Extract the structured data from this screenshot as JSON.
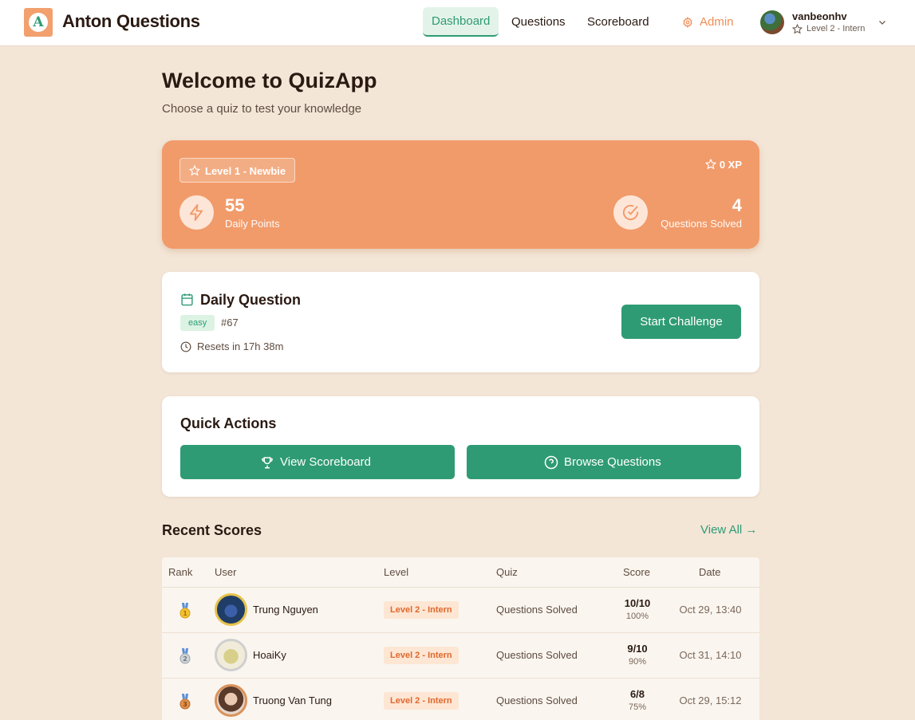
{
  "header": {
    "logo_letter": "A",
    "brand": "Anton Questions",
    "nav": [
      "Dashboard",
      "Questions",
      "Scoreboard"
    ],
    "admin": "Admin",
    "user": {
      "name": "vanbeonhv",
      "level": "Level 2 - Intern"
    }
  },
  "main": {
    "title": "Welcome to QuizApp",
    "subtitle": "Choose a quiz to test your knowledge"
  },
  "stats": {
    "level": "Level 1  - Newbie",
    "xp": "0 XP",
    "daily_points": "55",
    "daily_points_label": "Daily Points",
    "questions_solved": "4",
    "questions_solved_label": "Questions Solved"
  },
  "daily_question": {
    "title": "Daily Question",
    "difficulty": "easy",
    "number": "#67",
    "reset": "Resets in 17h 38m",
    "button": "Start Challenge"
  },
  "quick_actions": {
    "title": "Quick Actions",
    "scoreboard": "View Scoreboard",
    "browse": "Browse Questions"
  },
  "recent_scores": {
    "title": "Recent Scores",
    "view_all": "View All →",
    "columns": [
      "Rank",
      "User",
      "Level",
      "Quiz",
      "Score",
      "Date"
    ],
    "rows": [
      {
        "medal": "🥇",
        "name": "Trung Nguyen",
        "level": "Level 2 - Intern",
        "quiz": "Questions Solved",
        "score": "10/10",
        "pct": "100%",
        "date": "Oct 29, 13:40"
      },
      {
        "medal": "🥈",
        "name": "HoaiKy",
        "level": "Level 2 - Intern",
        "quiz": "Questions Solved",
        "score": "9/10",
        "pct": "90%",
        "date": "Oct 31, 14:10"
      },
      {
        "medal": "🥉",
        "name": "Truong Van Tung",
        "level": "Level 2 - Intern",
        "quiz": "Questions Solved",
        "score": "6/8",
        "pct": "75%",
        "date": "Oct 29, 15:12"
      }
    ]
  },
  "colors": {
    "accent_green": "#2e9b74",
    "accent_orange": "#f19b6a",
    "background": "#f3e6d7"
  }
}
